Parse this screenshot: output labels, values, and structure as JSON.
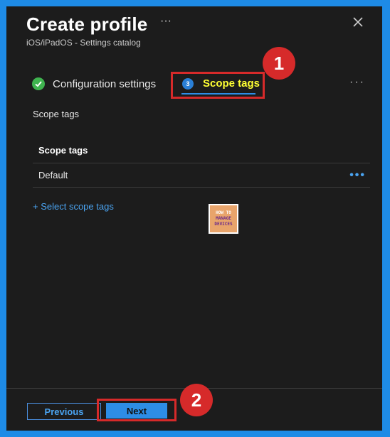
{
  "header": {
    "title": "Create profile",
    "more": "···",
    "subtitle": "iOS/iPadOS - Settings catalog",
    "close_icon": "close-icon"
  },
  "tabs": [
    {
      "label": "Configuration settings",
      "state": "completed",
      "icon": "check-icon"
    },
    {
      "label": "Scope tags",
      "state": "active",
      "step": "3"
    }
  ],
  "tabs_more": "···",
  "annotations": {
    "badge1": "1",
    "badge2": "2",
    "highlight_color": "#d62a2a"
  },
  "section": {
    "label": "Scope tags"
  },
  "table": {
    "header": "Scope tags",
    "rows": [
      {
        "name": "Default",
        "more": "•••"
      }
    ]
  },
  "add_link": "+ Select scope tags",
  "logo": {
    "line1": "HOW TO",
    "line2": "MANAGE",
    "line3": "DEVICES"
  },
  "footer": {
    "previous": "Previous",
    "next": "Next"
  },
  "colors": {
    "accent": "#2d8de6",
    "link": "#4aa3f0",
    "active_tab_text": "#ffff33",
    "success": "#3fb34f",
    "panel_bg": "#1c1c1c",
    "frame": "#1e8be6"
  }
}
